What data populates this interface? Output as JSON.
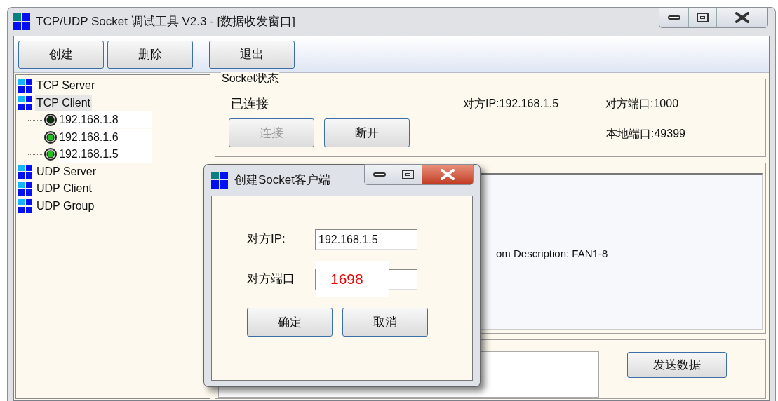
{
  "window": {
    "title": "TCP/UDP Socket 调试工具 V2.3 - [数据收发窗口]"
  },
  "toolbar": [
    "创建",
    "删除",
    "退出"
  ],
  "tree": [
    {
      "label": "TCP Server",
      "selected": false
    },
    {
      "label": "TCP Client",
      "selected": true,
      "children": [
        {
          "label": "192.168.1.8",
          "connected": false,
          "selected": false
        },
        {
          "label": "192.168.1.6",
          "connected": true,
          "selected": false
        },
        {
          "label": "192.168.1.5",
          "connected": true,
          "selected": false
        }
      ]
    },
    {
      "label": "UDP Server",
      "selected": false
    },
    {
      "label": "UDP Client",
      "selected": false
    },
    {
      "label": "UDP Group",
      "selected": false
    }
  ],
  "socket_status": {
    "title": "Socket状态",
    "state": "已连接",
    "remote_ip": "对方IP:192.168.1.5",
    "remote_port": "对方端口:1000",
    "local_port": "本地端口:49399",
    "buttons": [
      {
        "label": "连接",
        "disabled": true
      },
      {
        "label": "断开",
        "disabled": false
      }
    ]
  },
  "receive": {
    "lines": [
      "om Description: FAN1-8"
    ]
  },
  "send": {
    "button": "发送数据"
  },
  "dialog": {
    "title": "创建Socket客户端",
    "fields": [
      {
        "label": "对方IP:",
        "value": "192.168.1.5",
        "kind": "plain"
      },
      {
        "label": "对方端口",
        "value": "1698",
        "kind": "annotated"
      }
    ],
    "buttons": [
      "确定",
      "取消"
    ]
  }
}
